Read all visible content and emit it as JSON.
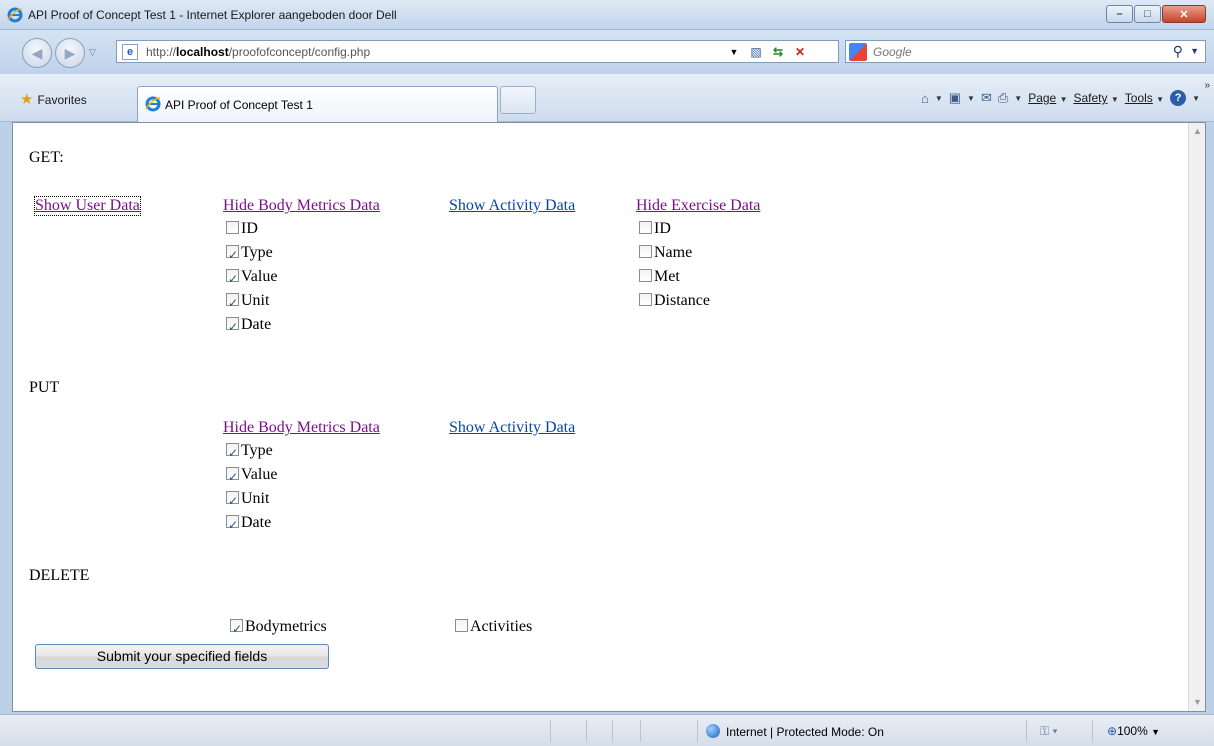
{
  "window": {
    "title": "API Proof of Concept Test 1 - Internet Explorer aangeboden door Dell",
    "controls": {
      "minimize": "–",
      "maximize": "□",
      "close": "✕"
    }
  },
  "address": {
    "url_prefix": "http://",
    "url_host": "localhost",
    "url_path": "/proofofconcept/config.php",
    "search_placeholder": "Google"
  },
  "commandbar": {
    "favorites": "Favorites",
    "tab_title": "API Proof of Concept Test 1",
    "menus": {
      "page": "Page",
      "safety": "Safety",
      "tools": "Tools"
    }
  },
  "page": {
    "get": {
      "heading": "GET:",
      "user_link": "Show User Data",
      "body_link": "Hide Body Metrics Data",
      "activity_link": "Show Activity Data",
      "exercise_link": "Hide Exercise Data",
      "body_fields": [
        {
          "label": "ID",
          "checked": false
        },
        {
          "label": "Type",
          "checked": true
        },
        {
          "label": "Value",
          "checked": true
        },
        {
          "label": "Unit",
          "checked": true
        },
        {
          "label": "Date",
          "checked": true
        }
      ],
      "exercise_fields": [
        {
          "label": "ID",
          "checked": false
        },
        {
          "label": "Name",
          "checked": false
        },
        {
          "label": "Met",
          "checked": false
        },
        {
          "label": "Distance",
          "checked": false
        }
      ]
    },
    "put": {
      "heading": "PUT",
      "body_link": "Hide Body Metrics Data",
      "activity_link": "Show Activity Data",
      "body_fields": [
        {
          "label": "Type",
          "checked": true
        },
        {
          "label": "Value",
          "checked": true
        },
        {
          "label": "Unit",
          "checked": true
        },
        {
          "label": "Date",
          "checked": true
        }
      ]
    },
    "delete": {
      "heading": "DELETE",
      "bodymetrics": {
        "label": "Bodymetrics",
        "checked": true
      },
      "activities": {
        "label": "Activities",
        "checked": false
      }
    },
    "submit_label": "Submit your specified fields"
  },
  "statusbar": {
    "zone": "Internet | Protected Mode: On",
    "zoom": "100%"
  }
}
